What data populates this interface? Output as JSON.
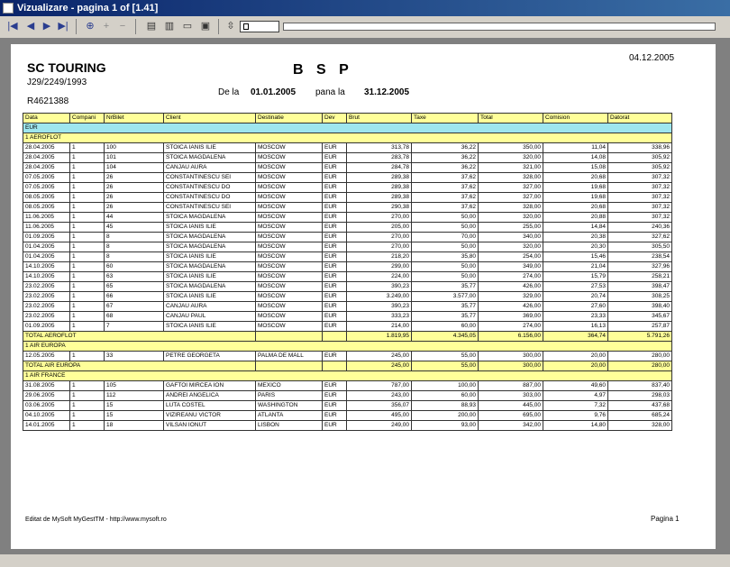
{
  "window": {
    "title": "Vizualizare  - pagina 1 of [1.41]"
  },
  "report": {
    "company": "SC TOURING",
    "reg_no": "J29/2249/1993",
    "cif": "R4621388",
    "title": "B S P",
    "print_date": "04.12.2005",
    "period_from_label": "De la",
    "period_from": "01.01.2005",
    "period_to_label": "pana la",
    "period_to": "31.12.2005",
    "footer_left": "Editat de MySoft MyGestTM - http://www.mysoft.ro",
    "footer_right": "Pagina 1"
  },
  "table": {
    "headers": [
      "Data",
      "Compani",
      "NrBilet",
      "Client",
      "Destinatie",
      "Dev",
      "Brut",
      "Taxe",
      "Total",
      "Comision",
      "Datorat"
    ],
    "currency_row": "EUR",
    "groups": [
      {
        "name": "1 AEROFLOT",
        "rows": [
          [
            "28.04.2005",
            "1",
            "100",
            "STOICA IANIS ILIE",
            "MOSCOW",
            "EUR",
            "313,78",
            "36,22",
            "350,00",
            "11,04",
            "338,96"
          ],
          [
            "28.04.2005",
            "1",
            "101",
            "STOICA MAGDALENA",
            "MOSCOW",
            "EUR",
            "283,78",
            "36,22",
            "320,00",
            "14,08",
            "305,92"
          ],
          [
            "28.04.2005",
            "1",
            "104",
            "CANJAU AURA",
            "MOSCOW",
            "EUR",
            "284,78",
            "36,22",
            "321,00",
            "15,08",
            "305,92"
          ],
          [
            "07.05.2005",
            "1",
            "26",
            "CONSTANTINESCU SEI",
            "MOSCOW",
            "EUR",
            "289,38",
            "37,62",
            "328,00",
            "20,68",
            "307,32"
          ],
          [
            "07.05.2005",
            "1",
            "26",
            "CONSTANTINESCU DO",
            "MOSCOW",
            "EUR",
            "289,38",
            "37,62",
            "327,00",
            "19,68",
            "307,32"
          ],
          [
            "08.05.2005",
            "1",
            "26",
            "CONSTANTINESCU DO",
            "MOSCOW",
            "EUR",
            "289,38",
            "37,62",
            "327,00",
            "19,68",
            "307,32"
          ],
          [
            "08.05.2005",
            "1",
            "26",
            "CONSTANTINESCU SEI",
            "MOSCOW",
            "EUR",
            "290,38",
            "37,62",
            "328,00",
            "20,68",
            "307,32"
          ],
          [
            "11.06.2005",
            "1",
            "44",
            "STOICA MAGDALENA",
            "MOSCOW",
            "EUR",
            "270,00",
            "50,00",
            "320,00",
            "20,88",
            "307,32"
          ],
          [
            "11.06.2005",
            "1",
            "45",
            "STOICA IANIS ILIE",
            "MOSCOW",
            "EUR",
            "205,00",
            "50,00",
            "255,00",
            "14,84",
            "240,36"
          ],
          [
            "01.09.2005",
            "1",
            "8",
            "STOICA MAGDALENA",
            "MOSCOW",
            "EUR",
            "270,00",
            "70,00",
            "340,00",
            "20,38",
            "327,62"
          ],
          [
            "01.04.2005",
            "1",
            "8",
            "STOICA MAGDALENA",
            "MOSCOW",
            "EUR",
            "270,00",
            "50,00",
            "320,00",
            "20,30",
            "305,50"
          ],
          [
            "01.04.2005",
            "1",
            "8",
            "STOICA IANIS ILIE",
            "MOSCOW",
            "EUR",
            "218,20",
            "35,80",
            "254,00",
            "15,46",
            "238,54"
          ],
          [
            "14.10.2005",
            "1",
            "60",
            "STOICA MAGDALENA",
            "MOSCOW",
            "EUR",
            "299,00",
            "50,00",
            "349,00",
            "21,04",
            "327,96"
          ],
          [
            "14.10.2005",
            "1",
            "63",
            "STOICA IANIS ILIE",
            "MOSCOW",
            "EUR",
            "224,00",
            "50,00",
            "274,00",
            "15,79",
            "258,21"
          ],
          [
            "23.02.2005",
            "1",
            "65",
            "STOICA MAGDALENA",
            "MOSCOW",
            "EUR",
            "390,23",
            "35,77",
            "426,00",
            "27,53",
            "398,47"
          ],
          [
            "23.02.2005",
            "1",
            "66",
            "STOICA IANIS ILIE",
            "MOSCOW",
            "EUR",
            "3.249,00",
            "3.577,00",
            "329,00",
            "20,74",
            "308,25"
          ],
          [
            "23.02.2005",
            "1",
            "67",
            "CANJAU AURA",
            "MOSCOW",
            "EUR",
            "390,23",
            "35,77",
            "426,00",
            "27,60",
            "398,40"
          ],
          [
            "23.02.2005",
            "1",
            "68",
            "CANJAU PAUL",
            "MOSCOW",
            "EUR",
            "333,23",
            "35,77",
            "369,00",
            "23,33",
            "345,67"
          ],
          [
            "01.09.2005",
            "1",
            "7",
            "STOICA IANIS ILIE",
            "MOSCOW",
            "EUR",
            "214,00",
            "60,00",
            "274,00",
            "16,13",
            "257,87"
          ]
        ],
        "total": [
          "TOTAL AEROFLOT",
          "1.819,95",
          "4.345,05",
          "6.156,00",
          "364,74",
          "5.791,26"
        ]
      },
      {
        "name": "1 AIR EUROPA",
        "rows": [
          [
            "12.05.2005",
            "1",
            "33",
            "PETRE GEORGETA",
            "PALMA DE MALL",
            "EUR",
            "245,00",
            "55,00",
            "300,00",
            "20,00",
            "280,00"
          ]
        ],
        "total": [
          "TOTAL AIR EUROPA",
          "245,00",
          "55,00",
          "300,00",
          "20,00",
          "280,00"
        ]
      },
      {
        "name": "1 AIR FRANCE",
        "rows": [
          [
            "31.08.2005",
            "1",
            "105",
            "GAFTOI MIRCEA ION",
            "MEXICO",
            "EUR",
            "787,00",
            "100,00",
            "887,00",
            "49,60",
            "837,40"
          ],
          [
            "29.06.2005",
            "1",
            "112",
            "ANDREI ANGELICA",
            "PARIS",
            "EUR",
            "243,00",
            "60,00",
            "303,00",
            "4,97",
            "298,03"
          ],
          [
            "03.06.2005",
            "1",
            "15",
            "LUTA COSTEL",
            "WASHINGTON",
            "EUR",
            "356,07",
            "88,93",
            "445,00",
            "7,32",
            "437,68"
          ],
          [
            "04.10.2005",
            "1",
            "15",
            "VIZIREANU VICTOR",
            "ATLANTA",
            "EUR",
            "495,00",
            "200,00",
            "695,00",
            "9,76",
            "685,24"
          ],
          [
            "14.01.2005",
            "1",
            "18",
            "VILSAN IONUT",
            "LISBON",
            "EUR",
            "249,00",
            "93,00",
            "342,00",
            "14,80",
            "328,00"
          ]
        ]
      }
    ]
  }
}
